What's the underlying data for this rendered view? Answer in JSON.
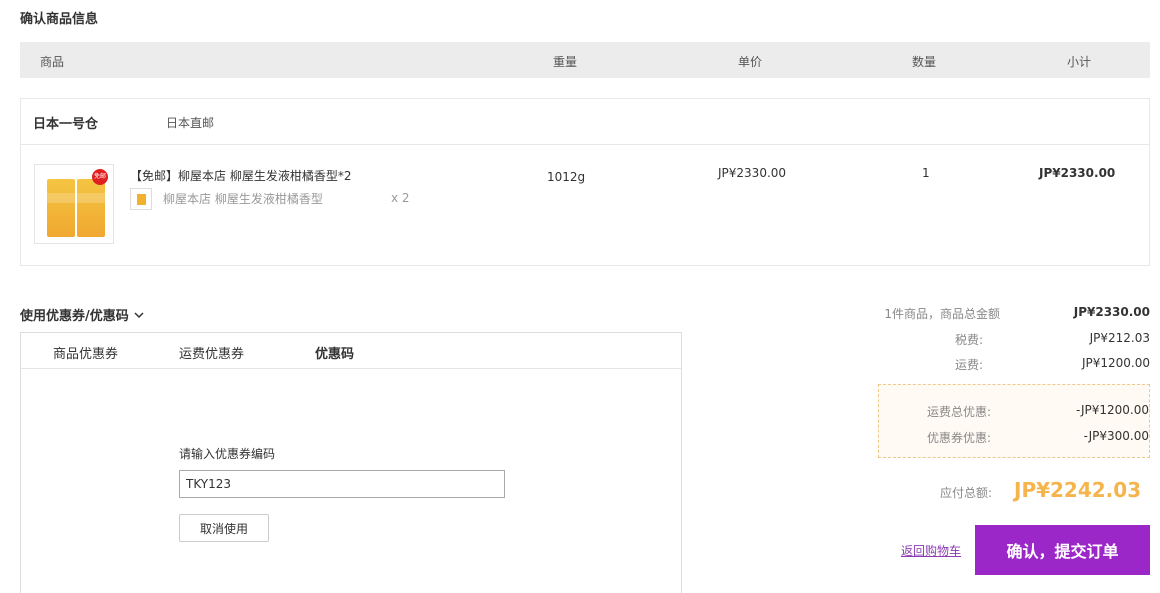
{
  "section_title": "确认商品信息",
  "table_header": {
    "product": "商品",
    "weight": "重量",
    "unit_price": "单价",
    "quantity": "数量",
    "subtotal": "小计"
  },
  "warehouse": {
    "name": "日本一号仓",
    "shipping_mode": "日本直邮"
  },
  "product": {
    "badge": "免邮",
    "title": "【免邮】柳屋本店 柳屋生发液柑橘香型*2",
    "variant_name": "柳屋本店 柳屋生发液柑橘香型",
    "variant_qty": "x 2",
    "weight": "1012g",
    "unit_price": "JP¥2330.00",
    "quantity": "1",
    "subtotal": "JP¥2330.00"
  },
  "coupon": {
    "toggle_label": "使用优惠券/优惠码",
    "tabs": [
      {
        "label": "商品优惠券",
        "active": false
      },
      {
        "label": "运费优惠券",
        "active": false
      },
      {
        "label": "优惠码",
        "active": true
      }
    ],
    "code_label": "请输入优惠券编码",
    "code_value": "TKY123",
    "cancel_label": "取消使用"
  },
  "summary": {
    "goods_total_label": "1件商品，商品总金额",
    "goods_total_value": "JP¥2330.00",
    "tax_label": "税费:",
    "tax_value": "JP¥212.03",
    "shipping_label": "运费:",
    "shipping_value": "JP¥1200.00",
    "shipping_discount_label": "运费总优惠:",
    "shipping_discount_value": "-JP¥1200.00",
    "coupon_discount_label": "优惠券优惠:",
    "coupon_discount_value": "-JP¥300.00",
    "total_label": "应付总额:",
    "total_value": "JP¥2242.03"
  },
  "actions": {
    "back_label": "返回购物车",
    "submit_label": "确认，提交订单"
  },
  "colors": {
    "accent_purple": "#9c27c9",
    "total_orange": "#f5b44c",
    "header_bg": "#ececec"
  }
}
